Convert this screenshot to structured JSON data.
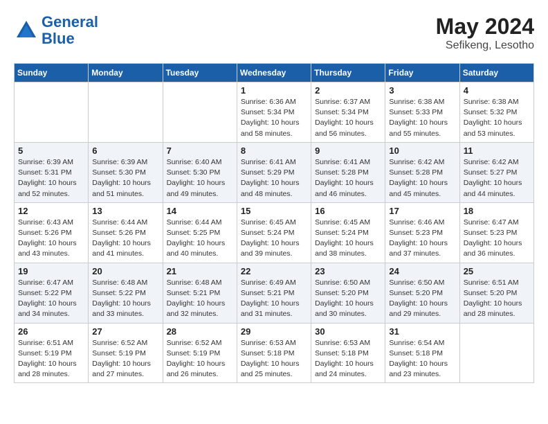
{
  "header": {
    "logo_line1": "General",
    "logo_line2": "Blue",
    "month_year": "May 2024",
    "location": "Sefikeng, Lesotho"
  },
  "weekdays": [
    "Sunday",
    "Monday",
    "Tuesday",
    "Wednesday",
    "Thursday",
    "Friday",
    "Saturday"
  ],
  "weeks": [
    [
      {
        "day": "",
        "info": ""
      },
      {
        "day": "",
        "info": ""
      },
      {
        "day": "",
        "info": ""
      },
      {
        "day": "1",
        "info": "Sunrise: 6:36 AM\nSunset: 5:34 PM\nDaylight: 10 hours\nand 58 minutes."
      },
      {
        "day": "2",
        "info": "Sunrise: 6:37 AM\nSunset: 5:34 PM\nDaylight: 10 hours\nand 56 minutes."
      },
      {
        "day": "3",
        "info": "Sunrise: 6:38 AM\nSunset: 5:33 PM\nDaylight: 10 hours\nand 55 minutes."
      },
      {
        "day": "4",
        "info": "Sunrise: 6:38 AM\nSunset: 5:32 PM\nDaylight: 10 hours\nand 53 minutes."
      }
    ],
    [
      {
        "day": "5",
        "info": "Sunrise: 6:39 AM\nSunset: 5:31 PM\nDaylight: 10 hours\nand 52 minutes."
      },
      {
        "day": "6",
        "info": "Sunrise: 6:39 AM\nSunset: 5:30 PM\nDaylight: 10 hours\nand 51 minutes."
      },
      {
        "day": "7",
        "info": "Sunrise: 6:40 AM\nSunset: 5:30 PM\nDaylight: 10 hours\nand 49 minutes."
      },
      {
        "day": "8",
        "info": "Sunrise: 6:41 AM\nSunset: 5:29 PM\nDaylight: 10 hours\nand 48 minutes."
      },
      {
        "day": "9",
        "info": "Sunrise: 6:41 AM\nSunset: 5:28 PM\nDaylight: 10 hours\nand 46 minutes."
      },
      {
        "day": "10",
        "info": "Sunrise: 6:42 AM\nSunset: 5:28 PM\nDaylight: 10 hours\nand 45 minutes."
      },
      {
        "day": "11",
        "info": "Sunrise: 6:42 AM\nSunset: 5:27 PM\nDaylight: 10 hours\nand 44 minutes."
      }
    ],
    [
      {
        "day": "12",
        "info": "Sunrise: 6:43 AM\nSunset: 5:26 PM\nDaylight: 10 hours\nand 43 minutes."
      },
      {
        "day": "13",
        "info": "Sunrise: 6:44 AM\nSunset: 5:26 PM\nDaylight: 10 hours\nand 41 minutes."
      },
      {
        "day": "14",
        "info": "Sunrise: 6:44 AM\nSunset: 5:25 PM\nDaylight: 10 hours\nand 40 minutes."
      },
      {
        "day": "15",
        "info": "Sunrise: 6:45 AM\nSunset: 5:24 PM\nDaylight: 10 hours\nand 39 minutes."
      },
      {
        "day": "16",
        "info": "Sunrise: 6:45 AM\nSunset: 5:24 PM\nDaylight: 10 hours\nand 38 minutes."
      },
      {
        "day": "17",
        "info": "Sunrise: 6:46 AM\nSunset: 5:23 PM\nDaylight: 10 hours\nand 37 minutes."
      },
      {
        "day": "18",
        "info": "Sunrise: 6:47 AM\nSunset: 5:23 PM\nDaylight: 10 hours\nand 36 minutes."
      }
    ],
    [
      {
        "day": "19",
        "info": "Sunrise: 6:47 AM\nSunset: 5:22 PM\nDaylight: 10 hours\nand 34 minutes."
      },
      {
        "day": "20",
        "info": "Sunrise: 6:48 AM\nSunset: 5:22 PM\nDaylight: 10 hours\nand 33 minutes."
      },
      {
        "day": "21",
        "info": "Sunrise: 6:48 AM\nSunset: 5:21 PM\nDaylight: 10 hours\nand 32 minutes."
      },
      {
        "day": "22",
        "info": "Sunrise: 6:49 AM\nSunset: 5:21 PM\nDaylight: 10 hours\nand 31 minutes."
      },
      {
        "day": "23",
        "info": "Sunrise: 6:50 AM\nSunset: 5:20 PM\nDaylight: 10 hours\nand 30 minutes."
      },
      {
        "day": "24",
        "info": "Sunrise: 6:50 AM\nSunset: 5:20 PM\nDaylight: 10 hours\nand 29 minutes."
      },
      {
        "day": "25",
        "info": "Sunrise: 6:51 AM\nSunset: 5:20 PM\nDaylight: 10 hours\nand 28 minutes."
      }
    ],
    [
      {
        "day": "26",
        "info": "Sunrise: 6:51 AM\nSunset: 5:19 PM\nDaylight: 10 hours\nand 28 minutes."
      },
      {
        "day": "27",
        "info": "Sunrise: 6:52 AM\nSunset: 5:19 PM\nDaylight: 10 hours\nand 27 minutes."
      },
      {
        "day": "28",
        "info": "Sunrise: 6:52 AM\nSunset: 5:19 PM\nDaylight: 10 hours\nand 26 minutes."
      },
      {
        "day": "29",
        "info": "Sunrise: 6:53 AM\nSunset: 5:18 PM\nDaylight: 10 hours\nand 25 minutes."
      },
      {
        "day": "30",
        "info": "Sunrise: 6:53 AM\nSunset: 5:18 PM\nDaylight: 10 hours\nand 24 minutes."
      },
      {
        "day": "31",
        "info": "Sunrise: 6:54 AM\nSunset: 5:18 PM\nDaylight: 10 hours\nand 23 minutes."
      },
      {
        "day": "",
        "info": ""
      }
    ]
  ]
}
